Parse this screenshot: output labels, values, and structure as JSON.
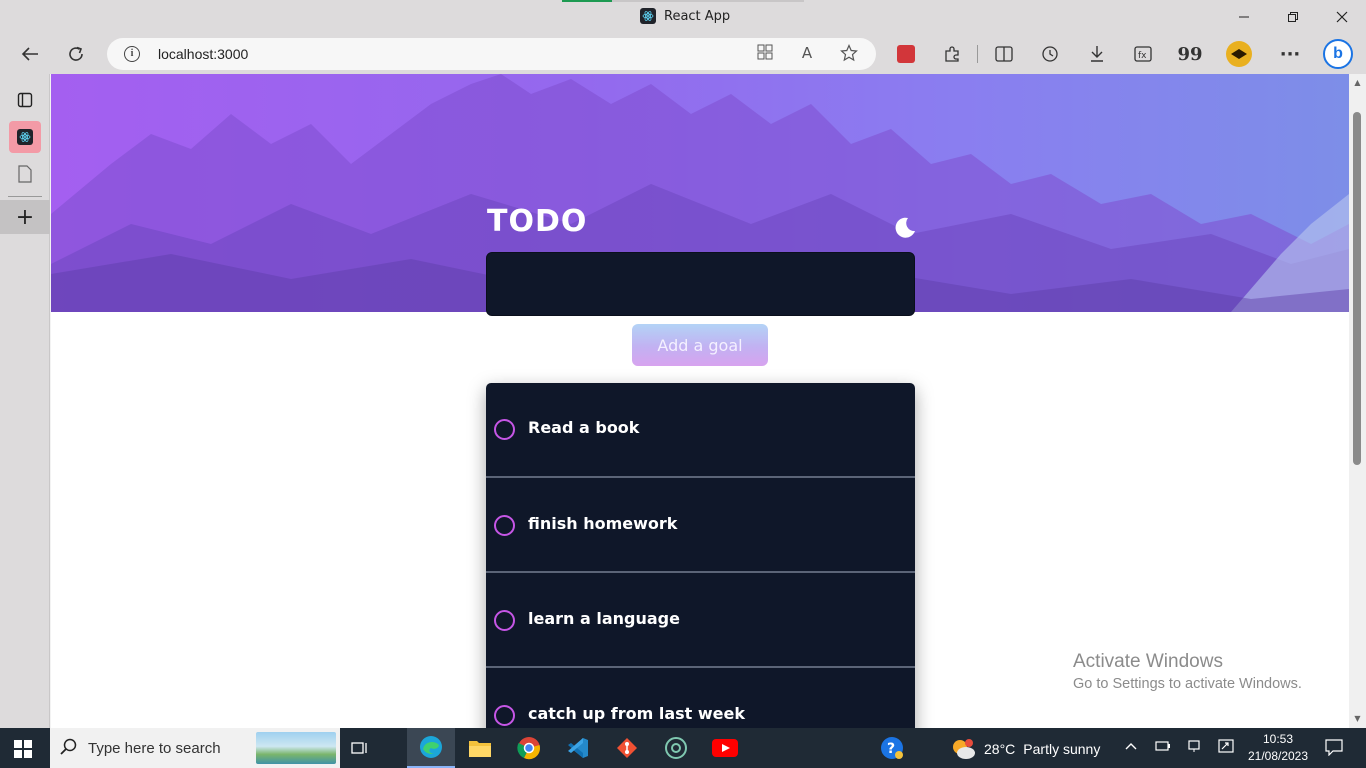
{
  "window": {
    "title": "React App",
    "controls": {
      "minimize": "—",
      "restore": "❐",
      "close": "✕"
    }
  },
  "browser": {
    "url": "localhost:3000",
    "info_icon": "i",
    "icons": [
      "back-icon",
      "refresh-icon",
      "app-available-icon",
      "read-aloud-icon",
      "favorite-star-icon",
      "extension-icon",
      "puzzle-extensions-icon",
      "split-screen-icon",
      "history-icon",
      "downloads-icon",
      "screenshot-icon",
      "quote-icon",
      "profile-avatar-icon",
      "more-menu-icon",
      "bing-copilot-icon"
    ],
    "quote_label": "99",
    "read_aloud_label": "A"
  },
  "sidebar": {
    "items": [
      "tab-actions-icon",
      "react-tab-icon",
      "page-tab-icon"
    ],
    "add_label": "+"
  },
  "app": {
    "title": "TODO",
    "input_value": "",
    "add_button_label": "Add a goal",
    "todos": [
      {
        "text": "Read a book",
        "done": false
      },
      {
        "text": "finish homework",
        "done": false
      },
      {
        "text": "learn a language",
        "done": false
      },
      {
        "text": "catch up from last week",
        "done": false
      }
    ],
    "theme_toggle": "moon-icon"
  },
  "watermark": {
    "line1": "Activate Windows",
    "line2": "Go to Settings to activate Windows."
  },
  "taskbar": {
    "search_placeholder": "Type here to search",
    "apps": [
      "task-view",
      "edge",
      "file-explorer",
      "chrome",
      "vscode",
      "git",
      "chatgpt",
      "youtube"
    ],
    "weather_temp": "28°C",
    "weather_text": "Partly sunny",
    "time": "10:53",
    "date": "21/08/2023"
  },
  "colors": {
    "accent_purple": "#c656e6",
    "panel_dark": "#0f1729",
    "hero_start": "#a45ff0",
    "hero_end": "#7d8ee8"
  }
}
